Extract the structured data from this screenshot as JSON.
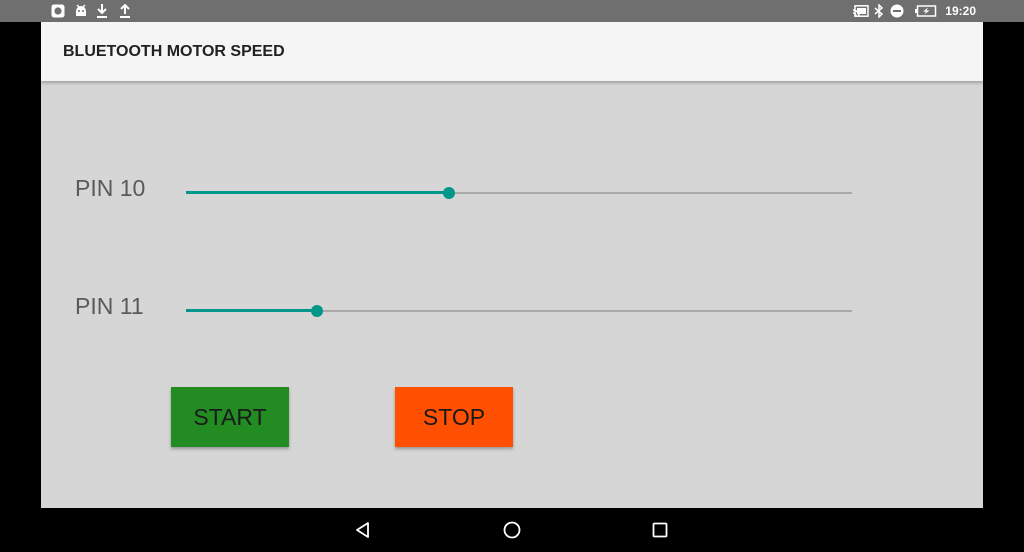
{
  "status_bar": {
    "time": "19:20",
    "left_icons": [
      "notification-app-icon",
      "android-debug-icon",
      "download-icon",
      "upload-icon"
    ],
    "right_icons": [
      "cast-icon",
      "bluetooth-icon",
      "do-not-disturb-icon",
      "battery-charging-icon"
    ]
  },
  "app_bar": {
    "title": "BLUETOOTH MOTOR SPEED"
  },
  "sliders": [
    {
      "label": "PIN 10",
      "value": 0.395
    },
    {
      "label": "PIN 11",
      "value": 0.197
    }
  ],
  "buttons": {
    "start": {
      "label": "START",
      "color": "#228b22"
    },
    "stop": {
      "label": "STOP",
      "color": "#ff4f00"
    }
  },
  "colors": {
    "accent": "#009688",
    "background": "#d6d6d6",
    "app_bar": "#f5f5f5",
    "status_bar": "#6f6f6f"
  },
  "nav_bar": {
    "icons": [
      "back-icon",
      "home-icon",
      "recents-icon"
    ]
  }
}
